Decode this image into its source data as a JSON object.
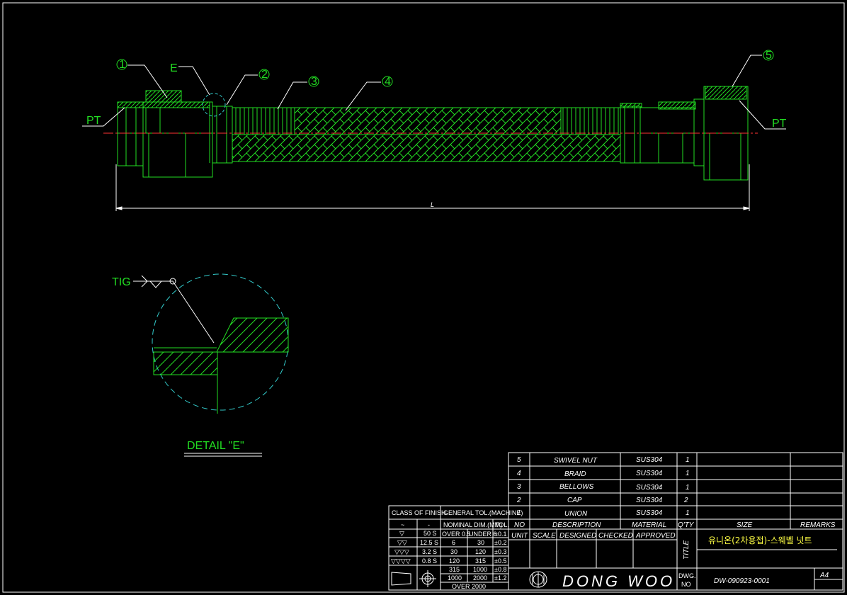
{
  "labels": {
    "balloons": [
      "1",
      "2",
      "3",
      "4",
      "5"
    ],
    "detail_marker": "E",
    "pt_left": "PT",
    "pt_right": "PT",
    "length": "L",
    "weld": "TIG",
    "detail_title": "DETAIL \"E\""
  },
  "bom": {
    "rows": [
      {
        "no": "5",
        "description": "SWIVEL NUT",
        "material": "SUS304",
        "qty": "1"
      },
      {
        "no": "4",
        "description": "BRAID",
        "material": "SUS304",
        "qty": "1"
      },
      {
        "no": "3",
        "description": "BELLOWS",
        "material": "SUS304",
        "qty": "1"
      },
      {
        "no": "2",
        "description": "CAP",
        "material": "SUS304",
        "qty": "2"
      },
      {
        "no": "1",
        "description": "UNION",
        "material": "SUS304",
        "qty": "1"
      }
    ],
    "headers": {
      "no": "NO",
      "description": "DESCRIPTION",
      "material": "MATERIAL",
      "qty": "Q'TY",
      "size": "SIZE",
      "remarks": "REMARKS"
    }
  },
  "title_block": {
    "unit": "UNIT",
    "scale": "SCALE",
    "designed": "DESIGNED",
    "checked": "CHECKED",
    "approved": "APPROVED",
    "title_label": "TITLE",
    "title": "유니온(2차용접)-스웨벨 넛트",
    "company": "DONG WOO",
    "dwg_no_label": "DWG. NO",
    "dwg_no": "DW-090923-0001",
    "size": "A4"
  },
  "finish": {
    "header": "CLASS OF FINISH",
    "rows": [
      {
        "symbol": "~",
        "value": "-"
      },
      {
        "symbol": "▽",
        "value": "50 S"
      },
      {
        "symbol": "▽▽",
        "value": "12.5 S"
      },
      {
        "symbol": "▽▽▽",
        "value": "3.2 S"
      },
      {
        "symbol": "▽▽▽▽",
        "value": "0.8 S"
      }
    ]
  },
  "tolerance": {
    "header": "GENERAL TOL.(MACHINE)",
    "col_nominal": "NOMINAL DIM.(MM)",
    "col_tol": "TOL.",
    "rows": [
      {
        "over": "OVER 0.5",
        "under": "UNDER 6",
        "tol": "±0.1"
      },
      {
        "over": "6",
        "under": "30",
        "tol": "±0.2"
      },
      {
        "over": "30",
        "under": "120",
        "tol": "±0.3"
      },
      {
        "over": "120",
        "under": "315",
        "tol": "±0.5"
      },
      {
        "over": "315",
        "under": "1000",
        "tol": "±0.8"
      },
      {
        "over": "1000",
        "under": "2000",
        "tol": "±1.2"
      }
    ],
    "last": "OVER 2000"
  },
  "colors": {
    "outline": "#22dd22",
    "centerline": "#ff3333",
    "leader": "#ffffff",
    "detail_circle": "#33cccc",
    "table": "#ffffff",
    "title": "#ffff44"
  }
}
